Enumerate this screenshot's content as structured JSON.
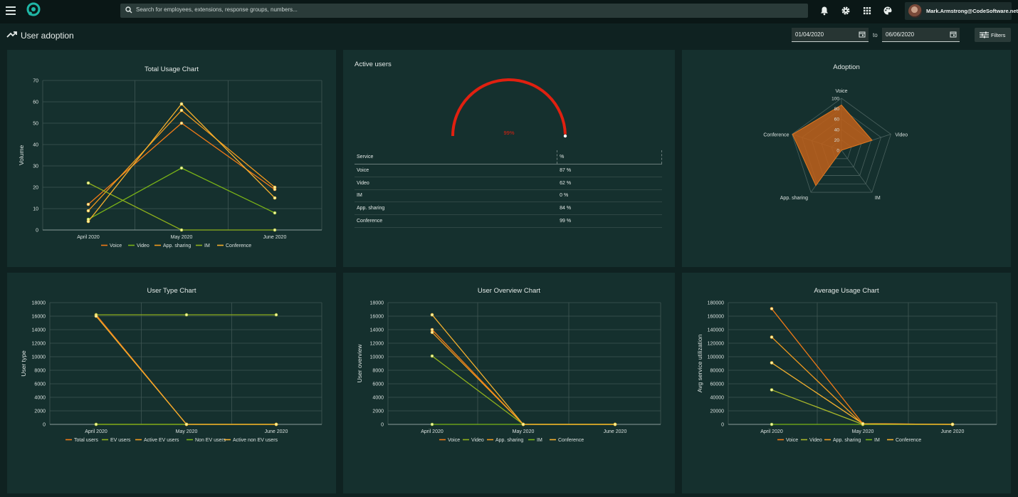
{
  "header": {
    "search_placeholder": "Search for employees, extensions, response groups, numbers...",
    "user_email": "Mark.Armstrong@CodeSoftware.net",
    "icons": [
      "menu-icon",
      "app-logo",
      "search-icon",
      "bell-icon",
      "gear-icon",
      "apps-grid-icon",
      "palette-icon",
      "avatar"
    ]
  },
  "page": {
    "title": "User adoption",
    "date_from": "01/04/2020",
    "date_to_label": "to",
    "date_to": "06/06/2020",
    "filters_label": "Filters"
  },
  "colors": {
    "orange": "#f07a17",
    "green": "#7ab317",
    "amber": "#f4a42a",
    "yellowgreen": "#a8b72a",
    "gauge_red": "#e02010"
  },
  "chart_data": [
    {
      "type": "line",
      "title": "Total Usage Chart",
      "ylabel": "Volume",
      "categories": [
        "April 2020",
        "May 2020",
        "June 2020"
      ],
      "yticks": [
        "0",
        "10",
        "20",
        "30",
        "40",
        "50",
        "60",
        "70"
      ],
      "ylim": [
        0,
        70
      ],
      "series": [
        {
          "name": "Voice",
          "color": "#f07a17",
          "values": [
            12,
            50,
            19
          ]
        },
        {
          "name": "Video",
          "color": "#7ab317",
          "values": [
            5,
            29,
            8
          ]
        },
        {
          "name": "App. sharing",
          "color": "#f29a1e",
          "values": [
            9,
            56,
            20
          ]
        },
        {
          "name": "IM",
          "color": "#8fb01c",
          "values": [
            22,
            0,
            0
          ]
        },
        {
          "name": "Conference",
          "color": "#f4b02e",
          "values": [
            4,
            59,
            15
          ]
        }
      ]
    },
    {
      "type": "gauge",
      "title": "Active users",
      "value_label": "99%",
      "value": 99,
      "table": {
        "headers": [
          "Service",
          "%"
        ],
        "rows": [
          [
            "Voice",
            "87 %"
          ],
          [
            "Video",
            "62 %"
          ],
          [
            "IM",
            "0 %"
          ],
          [
            "App. sharing",
            "84 %"
          ],
          [
            "Conference",
            "99 %"
          ]
        ]
      }
    },
    {
      "type": "radar",
      "title": "Adoption",
      "axes": [
        "Voice",
        "Video",
        "IM",
        "App. sharing",
        "Conference"
      ],
      "rticks": [
        "0",
        "20",
        "40",
        "60",
        "80",
        "100"
      ],
      "values": [
        87,
        62,
        0,
        84,
        99
      ]
    },
    {
      "type": "line",
      "title": "User Type Chart",
      "ylabel": "User type",
      "categories": [
        "April 2020",
        "May 2020",
        "June 2020"
      ],
      "yticks": [
        "0",
        "2000",
        "4000",
        "6000",
        "8000",
        "10000",
        "12000",
        "14000",
        "16000",
        "18000"
      ],
      "ylim": [
        0,
        18000
      ],
      "series": [
        {
          "name": "Total users",
          "color": "#f07a17",
          "values": [
            16200,
            0,
            0
          ]
        },
        {
          "name": "EV users",
          "color": "#8fb01c",
          "values": [
            16200,
            16200,
            16200
          ]
        },
        {
          "name": "Active EV users",
          "color": "#f29a1e",
          "values": [
            0,
            0,
            0
          ]
        },
        {
          "name": "Non EV users",
          "color": "#7ab317",
          "values": [
            0,
            0,
            0
          ]
        },
        {
          "name": "Active non EV users",
          "color": "#f4b02e",
          "values": [
            16000,
            0,
            0
          ]
        }
      ]
    },
    {
      "type": "line",
      "title": "User Overview Chart",
      "ylabel": "User overview",
      "categories": [
        "April 2020",
        "May 2020",
        "June 2020"
      ],
      "yticks": [
        "0",
        "2000",
        "4000",
        "6000",
        "8000",
        "10000",
        "12000",
        "14000",
        "16000",
        "18000"
      ],
      "ylim": [
        0,
        18000
      ],
      "series": [
        {
          "name": "Voice",
          "color": "#f07a17",
          "values": [
            14000,
            0,
            0
          ]
        },
        {
          "name": "Video",
          "color": "#8fb01c",
          "values": [
            10100,
            0,
            0
          ]
        },
        {
          "name": "App. sharing",
          "color": "#f29a1e",
          "values": [
            13600,
            0,
            0
          ]
        },
        {
          "name": "IM",
          "color": "#7ab317",
          "values": [
            0,
            0,
            0
          ]
        },
        {
          "name": "Conference",
          "color": "#f4b02e",
          "values": [
            16200,
            0,
            0
          ]
        }
      ]
    },
    {
      "type": "line",
      "title": "Average Usage Chart",
      "ylabel": "Avg service utilization",
      "categories": [
        "April 2020",
        "May 2020",
        "June 2020"
      ],
      "yticks": [
        "0",
        "20000",
        "40000",
        "60000",
        "80000",
        "100000",
        "120000",
        "140000",
        "160000",
        "180000"
      ],
      "ylim": [
        0,
        180000
      ],
      "series": [
        {
          "name": "Voice",
          "color": "#f07a17",
          "values": [
            171000,
            1000,
            0
          ]
        },
        {
          "name": "Video",
          "color": "#a8b72a",
          "values": [
            51000,
            0,
            0
          ]
        },
        {
          "name": "App. sharing",
          "color": "#f29a1e",
          "values": [
            129000,
            0,
            0
          ]
        },
        {
          "name": "IM",
          "color": "#7ab317",
          "values": [
            0,
            0,
            0
          ]
        },
        {
          "name": "Conference",
          "color": "#f4b02e",
          "values": [
            91000,
            1000,
            0
          ]
        }
      ]
    }
  ]
}
